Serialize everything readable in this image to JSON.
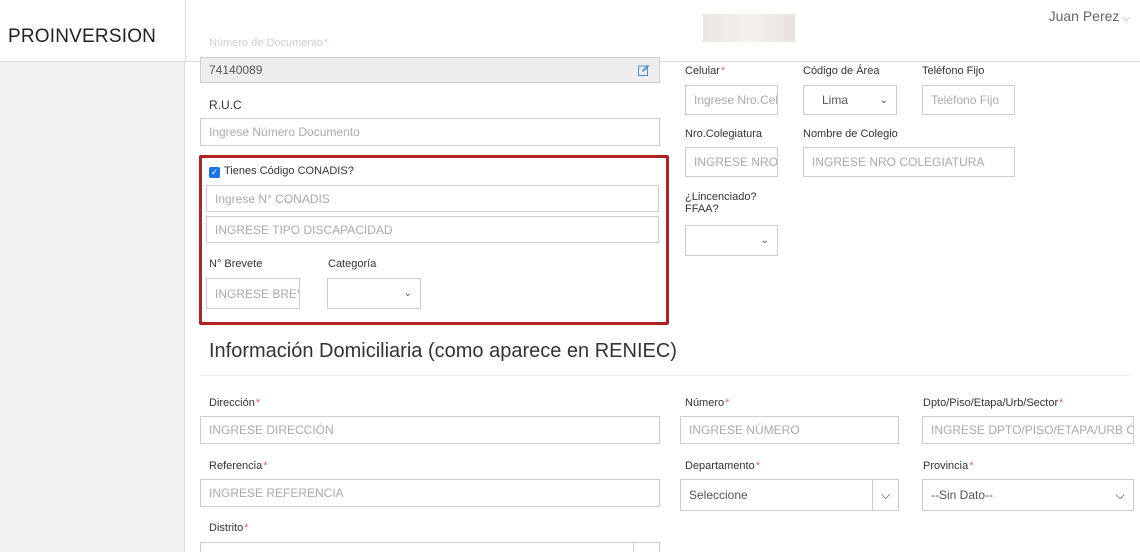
{
  "app": {
    "brand": "PROINVERSION",
    "user_name": "Juan Perez"
  },
  "top_label": "Número de Documento",
  "documento": {
    "value": "74140089"
  },
  "ruc": {
    "label": "R.U.C",
    "placeholder": "Ingrese Número Documento"
  },
  "conadis": {
    "checkbox_label": "Tienes Código CONADIS?",
    "code_placeholder": "Ingrese N° CONADIS",
    "tipo_placeholder": "INGRESE TIPO DISCAPACIDAD"
  },
  "brevete": {
    "label": "N° Brevete",
    "placeholder": "INGRESE BREVETE"
  },
  "categoria": {
    "label": "Categoría",
    "value": ""
  },
  "celular": {
    "label": "Celular",
    "placeholder": "Ingrese Nro.Celular"
  },
  "codigo_area": {
    "label": "Código de Área",
    "value": "Lima"
  },
  "telefono": {
    "label": "Teléfono Fijo",
    "placeholder": "Teléfono Fijo"
  },
  "colegiatura": {
    "label": "Nro.Colegiatura",
    "placeholder": "INGRESE NRO COLEGIATURA"
  },
  "colegio": {
    "label": "Nombre de Colegio",
    "placeholder": "INGRESE NRO COLEGIATURA"
  },
  "licenciado": {
    "label_line1": "¿Lincenciado?",
    "label_line2": "FFAA?",
    "value": ""
  },
  "domicilio": {
    "title": "Información Domiciliaria (como aparece en RENIEC)",
    "direccion": {
      "label": "Dirección",
      "placeholder": "INGRESE DIRECCIÓN"
    },
    "numero": {
      "label": "Número",
      "placeholder": "INGRESE NÚMERO"
    },
    "dpto": {
      "label": "Dpto/Piso/Etapa/Urb/Sector",
      "placeholder": "INGRESE DPTO/PISO/ETAPA/URB Ó"
    },
    "referencia": {
      "label": "Referencia",
      "placeholder": "INGRESE REFERENCIA"
    },
    "departamento": {
      "label": "Departamento",
      "value": "Seleccione"
    },
    "provincia": {
      "label": "Provincia",
      "value": "--Sin Dato--"
    },
    "distrito": {
      "label": "Distrito"
    }
  },
  "required_mark": "*",
  "icons": {
    "edit": "edit-icon",
    "chevron": "chevron-down-icon",
    "check": "check-icon"
  },
  "colors": {
    "highlight": "#b22222",
    "accent": "#1a73e8",
    "required": "#e06666"
  }
}
